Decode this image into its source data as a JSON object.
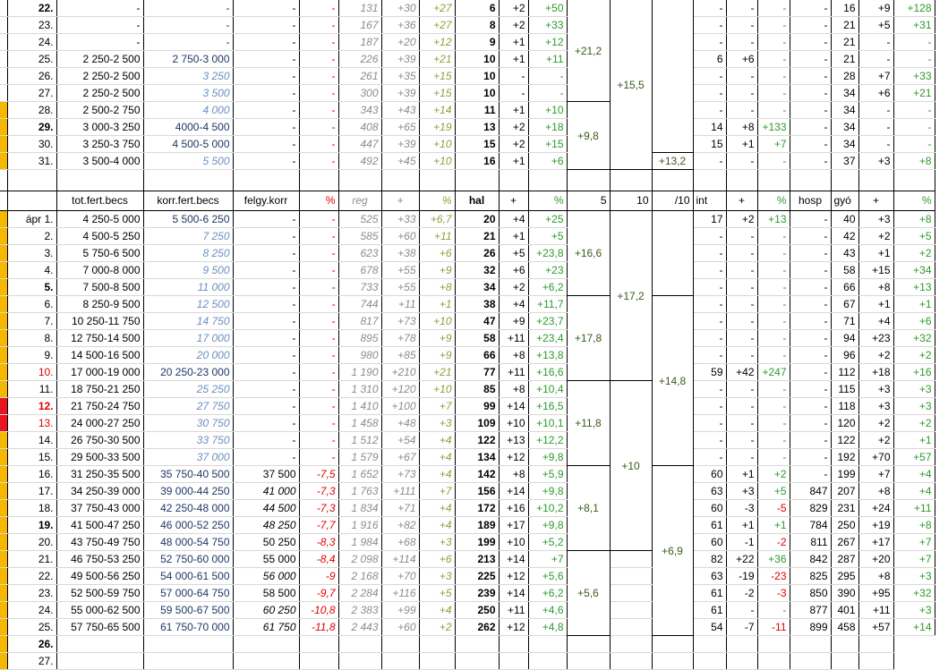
{
  "colors": {
    "orange": "#f5b800",
    "red": "#e8141e"
  },
  "top_rows": [
    {
      "mark": "",
      "d": "22.",
      "bold": true,
      "c1": "-",
      "c2": "-",
      "c2s": "n",
      "c3": "-",
      "c4": "-",
      "reg": "131",
      "rp": "+30",
      "rpc": "+27",
      "hal": "6",
      "hp": "+2",
      "hpc": "+50",
      "int": "-",
      "ip": "-",
      "ipc": "-",
      "hosp": "-",
      "gyo": "16",
      "gp": "+9",
      "gpc": "+128"
    },
    {
      "mark": "",
      "d": "23.",
      "bold": false,
      "c1": "-",
      "c2": "-",
      "c2s": "n",
      "c3": "-",
      "c4": "-",
      "reg": "167",
      "rp": "+36",
      "rpc": "+27",
      "hal": "8",
      "hp": "+2",
      "hpc": "+33",
      "int": "-",
      "ip": "-",
      "ipc": "-",
      "hosp": "-",
      "gyo": "21",
      "gp": "+5",
      "gpc": "+31"
    },
    {
      "mark": "",
      "d": "24.",
      "bold": false,
      "c1": "-",
      "c2": "-",
      "c2s": "n",
      "c3": "-",
      "c4": "-",
      "reg": "187",
      "rp": "+20",
      "rpc": "+12",
      "hal": "9",
      "hp": "+1",
      "hpc": "+12",
      "int": "-",
      "ip": "-",
      "ipc": "-",
      "hosp": "-",
      "gyo": "21",
      "gp": "-",
      "gpc": "-"
    },
    {
      "mark": "",
      "d": "25.",
      "bold": false,
      "c1": "2 250-2 500",
      "c2": "2 750-3 000",
      "c2s": "n",
      "c3": "-",
      "c4": "-",
      "reg": "226",
      "rp": "+39",
      "rpc": "+21",
      "hal": "10",
      "hp": "+1",
      "hpc": "+11",
      "int": "6",
      "ip": "+6",
      "ipc": "-",
      "hosp": "-",
      "gyo": "21",
      "gp": "-",
      "gpc": "-"
    },
    {
      "mark": "",
      "d": "26.",
      "bold": false,
      "c1": "2 250-2 500",
      "c2": "3 250",
      "c2s": "b",
      "c3": "-",
      "c4": "-",
      "reg": "261",
      "rp": "+35",
      "rpc": "+15",
      "hal": "10",
      "hp": "-",
      "hpc": "-",
      "int": "-",
      "ip": "-",
      "ipc": "-",
      "hosp": "-",
      "gyo": "28",
      "gp": "+7",
      "gpc": "+33"
    },
    {
      "mark": "",
      "d": "27.",
      "bold": false,
      "c1": "2 250-2 500",
      "c2": "3 500",
      "c2s": "b",
      "c3": "-",
      "c4": "-",
      "reg": "300",
      "rp": "+39",
      "rpc": "+15",
      "hal": "10",
      "hp": "-",
      "hpc": "-",
      "int": "-",
      "ip": "-",
      "ipc": "-",
      "hosp": "-",
      "gyo": "34",
      "gp": "+6",
      "gpc": "+21"
    },
    {
      "mark": "o",
      "d": "28.",
      "bold": false,
      "c1": "2 500-2 750",
      "c2": "4 000",
      "c2s": "b",
      "c3": "-",
      "c4": "-",
      "reg": "343",
      "rp": "+43",
      "rpc": "+14",
      "hal": "11",
      "hp": "+1",
      "hpc": "+10",
      "int": "-",
      "ip": "-",
      "ipc": "-",
      "hosp": "-",
      "gyo": "34",
      "gp": "-",
      "gpc": "-"
    },
    {
      "mark": "o",
      "d": "29.",
      "bold": true,
      "c1": "3 000-3 250",
      "c2": "4000-4 500",
      "c2s": "n",
      "c3": "-",
      "c4": "-",
      "reg": "408",
      "rp": "+65",
      "rpc": "+19",
      "hal": "13",
      "hp": "+2",
      "hpc": "+18",
      "int": "14",
      "ip": "+8",
      "ipc": "+133",
      "hosp": "-",
      "gyo": "34",
      "gp": "-",
      "gpc": "-"
    },
    {
      "mark": "o",
      "d": "30.",
      "bold": false,
      "c1": "3 250-3 750",
      "c2": "4 500-5 000",
      "c2s": "n",
      "c3": "-",
      "c4": "-",
      "reg": "447",
      "rp": "+39",
      "rpc": "+10",
      "hal": "15",
      "hp": "+2",
      "hpc": "+15",
      "int": "15",
      "ip": "+1",
      "ipc": "+7",
      "hosp": "-",
      "gyo": "34",
      "gp": "-",
      "gpc": "-"
    },
    {
      "mark": "o",
      "d": "31.",
      "bold": false,
      "c1": "3 500-4 000",
      "c2": "5 500",
      "c2s": "b",
      "c3": "-",
      "c4": "-",
      "reg": "492",
      "rp": "+45",
      "rpc": "+10",
      "hal": "16",
      "hp": "+1",
      "hpc": "+6",
      "int": "-",
      "ip": "-",
      "ipc": "-",
      "hosp": "-",
      "gyo": "37",
      "gp": "+3",
      "gpc": "+8"
    }
  ],
  "top_merged": {
    "five_a": "+21,2",
    "five_b": "+9,8",
    "ten_a": "+15,5",
    "per10": "+13,2"
  },
  "headers": [
    "tot.fert.becs",
    "korr.fert.becs",
    "felgy.korr",
    "%",
    "reg",
    "+",
    "%",
    "hal",
    "+",
    "%",
    "5",
    "10",
    "/10",
    "int",
    "+",
    "%",
    "hosp",
    "gyó",
    "+",
    "%"
  ],
  "rows": [
    {
      "mark": "o",
      "d": "ápr 1.",
      "dc": "",
      "bold": false,
      "c1": "4 250-5 000",
      "c2": "5 500-6 250",
      "c2s": "n",
      "c3": "-",
      "c3s": "n",
      "c4": "-",
      "reg": "525",
      "rp": "+33",
      "rpc": "+6,7",
      "hal": "20",
      "hp": "+4",
      "hpc": "+25",
      "int": "17",
      "ip": "+2",
      "ipc": "+13",
      "ipcs": "g",
      "hosp": "-",
      "gyo": "40",
      "gp": "+3",
      "gpc": "+8"
    },
    {
      "mark": "o",
      "d": "2.",
      "dc": "",
      "bold": false,
      "c1": "4 500-5 250",
      "c2": "7 250",
      "c2s": "b",
      "c3": "-",
      "c3s": "n",
      "c4": "-",
      "reg": "585",
      "rp": "+60",
      "rpc": "+11",
      "hal": "21",
      "hp": "+1",
      "hpc": "+5",
      "int": "-",
      "ip": "-",
      "ipc": "-",
      "ipcs": "g",
      "hosp": "-",
      "gyo": "42",
      "gp": "+2",
      "gpc": "+5"
    },
    {
      "mark": "o",
      "d": "3.",
      "dc": "",
      "bold": false,
      "c1": "5 750-6 500",
      "c2": "8 250",
      "c2s": "b",
      "c3": "-",
      "c3s": "n",
      "c4": "-",
      "reg": "623",
      "rp": "+38",
      "rpc": "+6",
      "hal": "26",
      "hp": "+5",
      "hpc": "+23,8",
      "int": "-",
      "ip": "-",
      "ipc": "-",
      "ipcs": "g",
      "hosp": "-",
      "gyo": "43",
      "gp": "+1",
      "gpc": "+2"
    },
    {
      "mark": "o",
      "d": "4.",
      "dc": "",
      "bold": false,
      "c1": "7 000-8 000",
      "c2": "9 500",
      "c2s": "b",
      "c3": "-",
      "c3s": "n",
      "c4": "-",
      "reg": "678",
      "rp": "+55",
      "rpc": "+9",
      "hal": "32",
      "hp": "+6",
      "hpc": "+23",
      "int": "-",
      "ip": "-",
      "ipc": "-",
      "ipcs": "g",
      "hosp": "-",
      "gyo": "58",
      "gp": "+15",
      "gpc": "+34"
    },
    {
      "mark": "o",
      "d": "5.",
      "dc": "",
      "bold": true,
      "c1": "7 500-8 500",
      "c2": "11 000",
      "c2s": "b",
      "c3": "-",
      "c3s": "n",
      "c4": "-",
      "reg": "733",
      "rp": "+55",
      "rpc": "+8",
      "hal": "34",
      "hp": "+2",
      "hpc": "+6,2",
      "int": "-",
      "ip": "-",
      "ipc": "-",
      "ipcs": "g",
      "hosp": "-",
      "gyo": "66",
      "gp": "+8",
      "gpc": "+13"
    },
    {
      "mark": "o",
      "d": "6.",
      "dc": "",
      "bold": false,
      "c1": "8 250-9 500",
      "c2": "12 500",
      "c2s": "b",
      "c3": "-",
      "c3s": "n",
      "c4": "-",
      "reg": "744",
      "rp": "+11",
      "rpc": "+1",
      "hal": "38",
      "hp": "+4",
      "hpc": "+11,7",
      "int": "-",
      "ip": "-",
      "ipc": "-",
      "ipcs": "g",
      "hosp": "-",
      "gyo": "67",
      "gp": "+1",
      "gpc": "+1"
    },
    {
      "mark": "o",
      "d": "7.",
      "dc": "",
      "bold": false,
      "c1": "10 250-11 750",
      "c2": "14 750",
      "c2s": "b",
      "c3": "-",
      "c3s": "n",
      "c4": "-",
      "reg": "817",
      "rp": "+73",
      "rpc": "+10",
      "hal": "47",
      "hp": "+9",
      "hpc": "+23,7",
      "int": "-",
      "ip": "-",
      "ipc": "-",
      "ipcs": "g",
      "hosp": "-",
      "gyo": "71",
      "gp": "+4",
      "gpc": "+6"
    },
    {
      "mark": "o",
      "d": "8.",
      "dc": "",
      "bold": false,
      "c1": "12 750-14 500",
      "c2": "17 000",
      "c2s": "b",
      "c3": "-",
      "c3s": "n",
      "c4": "-",
      "reg": "895",
      "rp": "+78",
      "rpc": "+9",
      "hal": "58",
      "hp": "+11",
      "hpc": "+23,4",
      "int": "-",
      "ip": "-",
      "ipc": "-",
      "ipcs": "g",
      "hosp": "-",
      "gyo": "94",
      "gp": "+23",
      "gpc": "+32"
    },
    {
      "mark": "o",
      "d": "9.",
      "dc": "",
      "bold": false,
      "c1": "14 500-16 500",
      "c2": "20 000",
      "c2s": "b",
      "c3": "-",
      "c3s": "n",
      "c4": "-",
      "reg": "980",
      "rp": "+85",
      "rpc": "+9",
      "hal": "66",
      "hp": "+8",
      "hpc": "+13,8",
      "int": "-",
      "ip": "-",
      "ipc": "-",
      "ipcs": "g",
      "hosp": "-",
      "gyo": "96",
      "gp": "+2",
      "gpc": "+2"
    },
    {
      "mark": "o",
      "d": "10.",
      "dc": "red",
      "bold": false,
      "c1": "17 000-19 000",
      "c2": "20 250-23 000",
      "c2s": "n",
      "c3": "-",
      "c3s": "n",
      "c4": "-",
      "reg": "1 190",
      "rp": "+210",
      "rpc": "+21",
      "hal": "77",
      "hp": "+11",
      "hpc": "+16,6",
      "int": "59",
      "ip": "+42",
      "ipc": "+247",
      "ipcs": "g",
      "hosp": "-",
      "gyo": "112",
      "gp": "+18",
      "gpc": "+16"
    },
    {
      "mark": "o",
      "d": "11.",
      "dc": "",
      "bold": false,
      "c1": "18 750-21 250",
      "c2": "25 250",
      "c2s": "b",
      "c3": "-",
      "c3s": "n",
      "c4": "-",
      "reg": "1 310",
      "rp": "+120",
      "rpc": "+10",
      "hal": "85",
      "hp": "+8",
      "hpc": "+10,4",
      "int": "-",
      "ip": "-",
      "ipc": "-",
      "ipcs": "g",
      "hosp": "-",
      "gyo": "115",
      "gp": "+3",
      "gpc": "+3"
    },
    {
      "mark": "r",
      "d": "12.",
      "dc": "red",
      "bold": true,
      "c1": "21 750-24 750",
      "c2": "27 750",
      "c2s": "b",
      "c3": "-",
      "c3s": "n",
      "c4": "-",
      "reg": "1 410",
      "rp": "+100",
      "rpc": "+7",
      "hal": "99",
      "hp": "+14",
      "hpc": "+16,5",
      "int": "-",
      "ip": "-",
      "ipc": "-",
      "ipcs": "g",
      "hosp": "-",
      "gyo": "118",
      "gp": "+3",
      "gpc": "+3"
    },
    {
      "mark": "r",
      "d": "13.",
      "dc": "red",
      "bold": false,
      "c1": "24 000-27 250",
      "c2": "30 750",
      "c2s": "b",
      "c3": "-",
      "c3s": "n",
      "c4": "-",
      "reg": "1 458",
      "rp": "+48",
      "rpc": "+3",
      "hal": "109",
      "hp": "+10",
      "hpc": "+10,1",
      "int": "-",
      "ip": "-",
      "ipc": "-",
      "ipcs": "g",
      "hosp": "-",
      "gyo": "120",
      "gp": "+2",
      "gpc": "+2"
    },
    {
      "mark": "o",
      "d": "14.",
      "dc": "",
      "bold": false,
      "c1": "26 750-30 500",
      "c2": "33 750",
      "c2s": "b",
      "c3": "-",
      "c3s": "n",
      "c4": "-",
      "reg": "1 512",
      "rp": "+54",
      "rpc": "+4",
      "hal": "122",
      "hp": "+13",
      "hpc": "+12,2",
      "int": "-",
      "ip": "-",
      "ipc": "-",
      "ipcs": "g",
      "hosp": "-",
      "gyo": "122",
      "gp": "+2",
      "gpc": "+1"
    },
    {
      "mark": "o",
      "d": "15.",
      "dc": "",
      "bold": false,
      "c1": "29 500-33 500",
      "c2": "37 000",
      "c2s": "b",
      "c3": "-",
      "c3s": "n",
      "c4": "-",
      "reg": "1 579",
      "rp": "+67",
      "rpc": "+4",
      "hal": "134",
      "hp": "+12",
      "hpc": "+9,8",
      "int": "-",
      "ip": "-",
      "ipc": "-",
      "ipcs": "g",
      "hosp": "-",
      "gyo": "192",
      "gp": "+70",
      "gpc": "+57"
    },
    {
      "mark": "o",
      "d": "16.",
      "dc": "",
      "bold": false,
      "c1": "31 250-35 500",
      "c2": "35 750-40 500",
      "c2s": "n",
      "c3": "37 500",
      "c3s": "n",
      "c4": "-7,5",
      "reg": "1 652",
      "rp": "+73",
      "rpc": "+4",
      "hal": "142",
      "hp": "+8",
      "hpc": "+5,9",
      "int": "60",
      "ip": "+1",
      "ipc": "+2",
      "ipcs": "g",
      "hosp": "-",
      "gyo": "199",
      "gp": "+7",
      "gpc": "+4"
    },
    {
      "mark": "o",
      "d": "17.",
      "dc": "",
      "bold": false,
      "c1": "34 250-39 000",
      "c2": "39 000-44 250",
      "c2s": "n",
      "c3": "41 000",
      "c3s": "i",
      "c4": "-7,3",
      "reg": "1 763",
      "rp": "+111",
      "rpc": "+7",
      "hal": "156",
      "hp": "+14",
      "hpc": "+9,8",
      "int": "63",
      "ip": "+3",
      "ipc": "+5",
      "ipcs": "g",
      "hosp": "847",
      "gyo": "207",
      "gp": "+8",
      "gpc": "+4"
    },
    {
      "mark": "o",
      "d": "18.",
      "dc": "",
      "bold": false,
      "c1": "37 750-43 000",
      "c2": "42 250-48 000",
      "c2s": "n",
      "c3": "44 500",
      "c3s": "i",
      "c4": "-7,3",
      "reg": "1 834",
      "rp": "+71",
      "rpc": "+4",
      "hal": "172",
      "hp": "+16",
      "hpc": "+10,2",
      "int": "60",
      "ip": "-3",
      "ipc": "-5",
      "ipcs": "r",
      "hosp": "829",
      "gyo": "231",
      "gp": "+24",
      "gpc": "+11"
    },
    {
      "mark": "o",
      "d": "19.",
      "dc": "",
      "bold": true,
      "c1": "41 500-47 250",
      "c2": "46 000-52 250",
      "c2s": "n",
      "c3": "48 250",
      "c3s": "i",
      "c4": "-7,7",
      "reg": "1 916",
      "rp": "+82",
      "rpc": "+4",
      "hal": "189",
      "hp": "+17",
      "hpc": "+9,8",
      "int": "61",
      "ip": "+1",
      "ipc": "+1",
      "ipcs": "g",
      "hosp": "784",
      "gyo": "250",
      "gp": "+19",
      "gpc": "+8"
    },
    {
      "mark": "o",
      "d": "20.",
      "dc": "",
      "bold": false,
      "c1": "43 750-49 750",
      "c2": "48 000-54 750",
      "c2s": "n",
      "c3": "50 250",
      "c3s": "n",
      "c4": "-8,3",
      "reg": "1 984",
      "rp": "+68",
      "rpc": "+3",
      "hal": "199",
      "hp": "+10",
      "hpc": "+5,2",
      "int": "60",
      "ip": "-1",
      "ipc": "-2",
      "ipcs": "r",
      "hosp": "811",
      "gyo": "267",
      "gp": "+17",
      "gpc": "+7"
    },
    {
      "mark": "o",
      "d": "21.",
      "dc": "",
      "bold": false,
      "c1": "46 750-53 250",
      "c2": "52 750-60 000",
      "c2s": "n",
      "c3": "55 000",
      "c3s": "n",
      "c4": "-8,4",
      "reg": "2 098",
      "rp": "+114",
      "rpc": "+6",
      "hal": "213",
      "hp": "+14",
      "hpc": "+7",
      "int": "82",
      "ip": "+22",
      "ipc": "+36",
      "ipcs": "g",
      "hosp": "842",
      "gyo": "287",
      "gp": "+20",
      "gpc": "+7"
    },
    {
      "mark": "o",
      "d": "22.",
      "dc": "",
      "bold": false,
      "c1": "49 500-56 250",
      "c2": "54 000-61 500",
      "c2s": "n",
      "c3": "56 000",
      "c3s": "i",
      "c4": "-9",
      "reg": "2 168",
      "rp": "+70",
      "rpc": "+3",
      "hal": "225",
      "hp": "+12",
      "hpc": "+5,6",
      "int": "63",
      "ip": "-19",
      "ipc": "-23",
      "ipcs": "r",
      "hosp": "825",
      "gyo": "295",
      "gp": "+8",
      "gpc": "+3"
    },
    {
      "mark": "o",
      "d": "23.",
      "dc": "",
      "bold": false,
      "c1": "52 500-59 750",
      "c2": "57 000-64 750",
      "c2s": "n",
      "c3": "58 500",
      "c3s": "n",
      "c4": "-9,7",
      "reg": "2 284",
      "rp": "+116",
      "rpc": "+5",
      "hal": "239",
      "hp": "+14",
      "hpc": "+6,2",
      "int": "61",
      "ip": "-2",
      "ipc": "-3",
      "ipcs": "r",
      "hosp": "850",
      "gyo": "390",
      "gp": "+95",
      "gpc": "+32"
    },
    {
      "mark": "o",
      "d": "24.",
      "dc": "",
      "bold": false,
      "c1": "55 000-62 500",
      "c2": "59 500-67 500",
      "c2s": "n",
      "c3": "60 250",
      "c3s": "i",
      "c4": "-10,8",
      "reg": "2 383",
      "rp": "+99",
      "rpc": "+4",
      "hal": "250",
      "hp": "+11",
      "hpc": "+4,6",
      "int": "61",
      "ip": "-",
      "ipc": "-",
      "ipcs": "g",
      "hosp": "877",
      "gyo": "401",
      "gp": "+11",
      "gpc": "+3"
    },
    {
      "mark": "o",
      "d": "25.",
      "dc": "",
      "bold": false,
      "c1": "57 750-65 500",
      "c2": "61 750-70 000",
      "c2s": "n",
      "c3": "61 750",
      "c3s": "i",
      "c4": "-11,8",
      "reg": "2 443",
      "rp": "+60",
      "rpc": "+2",
      "hal": "262",
      "hp": "+12",
      "hpc": "+4,8",
      "int": "54",
      "ip": "-7",
      "ipc": "-11",
      "ipcs": "r",
      "hosp": "899",
      "gyo": "458",
      "gp": "+57",
      "gpc": "+14"
    },
    {
      "mark": "o",
      "d": "26.",
      "dc": "",
      "bold": true,
      "c1": "",
      "c2": "",
      "c2s": "n",
      "c3": "",
      "c3s": "n",
      "c4": "",
      "reg": "",
      "rp": "",
      "rpc": "",
      "hal": "",
      "hp": "",
      "hpc": "",
      "int": "",
      "ip": "",
      "ipc": "",
      "ipcs": "g",
      "hosp": "",
      "gyo": "",
      "gp": "",
      "gpc": ""
    },
    {
      "mark": "o",
      "d": "27.",
      "dc": "",
      "bold": false,
      "c1": "",
      "c2": "",
      "c2s": "n",
      "c3": "",
      "c3s": "n",
      "c4": "",
      "reg": "",
      "rp": "",
      "rpc": "",
      "hal": "",
      "hp": "",
      "hpc": "",
      "int": "",
      "ip": "",
      "ipc": "",
      "ipcs": "g",
      "hosp": "",
      "gyo": "",
      "gp": "",
      "gpc": ""
    }
  ],
  "bottom_merged": {
    "five": [
      "+16,6",
      "+17,8",
      "+11,8",
      "+8,1",
      "+5,6"
    ],
    "ten": [
      "+17,2",
      "+10"
    ],
    "per10": [
      "+14,8",
      "+6,9"
    ]
  }
}
